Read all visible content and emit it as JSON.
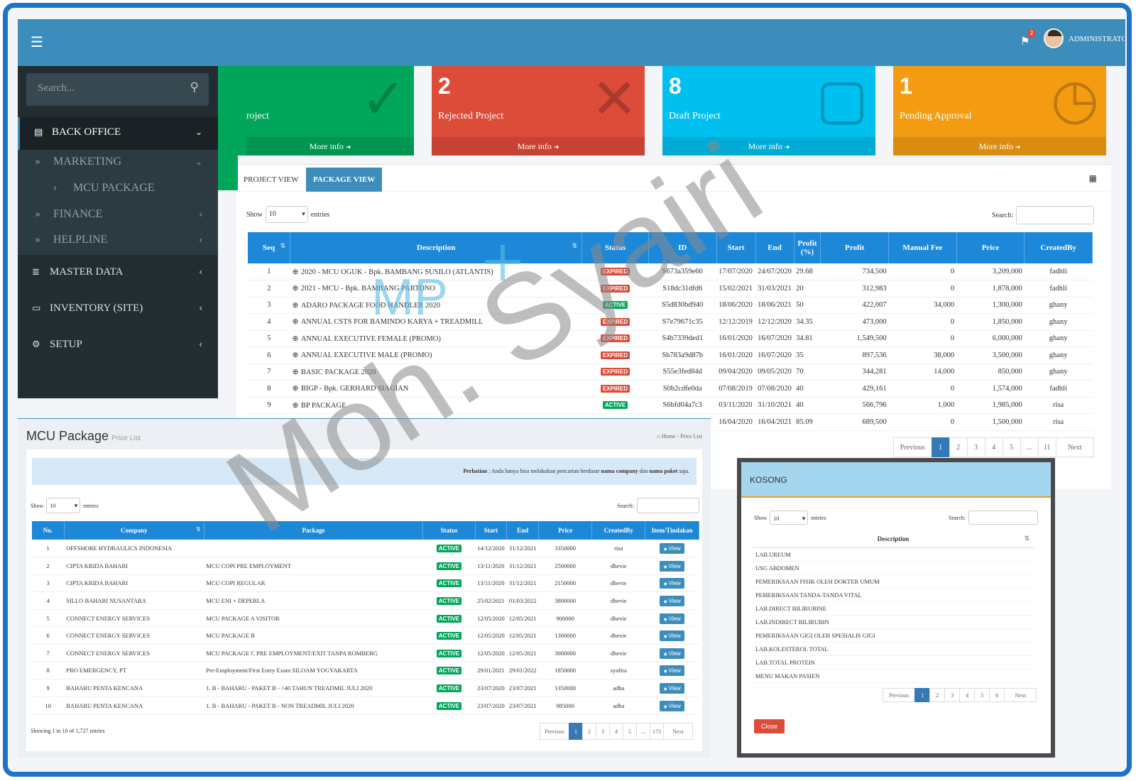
{
  "topbar": {
    "user": "ADMINISTRATOR",
    "flag_count": "2"
  },
  "sidebar": {
    "search_placeholder": "Search...",
    "items": [
      {
        "label": "BACK OFFICE"
      },
      {
        "label": "MARKETING"
      },
      {
        "label": "MCU PACKAGE"
      },
      {
        "label": "FINANCE"
      },
      {
        "label": "HELPLINE"
      },
      {
        "label": "MASTER DATA"
      },
      {
        "label": "INVENTORY (SITE)"
      },
      {
        "label": "SETUP"
      }
    ]
  },
  "info_boxes": [
    {
      "num": "",
      "label": "roject",
      "more": "More info",
      "color": "#00a65a"
    },
    {
      "num": "2",
      "label": "Rejected Project",
      "more": "More info",
      "color": "#dd4b39"
    },
    {
      "num": "8",
      "label": "Draft Project",
      "more": "More info",
      "color": "#00c0ef"
    },
    {
      "num": "1",
      "label": "Pending Approval",
      "more": "More info",
      "color": "#f39c12"
    }
  ],
  "tabs": {
    "project_view": "PROJECT VIEW",
    "package_view": "PACKAGE VIEW"
  },
  "pkg_table": {
    "show_label": "Show",
    "entries_value": "10",
    "entries_label": "entries",
    "search_label": "Search:",
    "headers": [
      "Seq",
      "Description",
      "Status",
      "ID",
      "Start",
      "End",
      "Profit (%)",
      "Profit",
      "Manual Fee",
      "Price",
      "CreatedBy"
    ],
    "rows": [
      [
        "1",
        "2020 - MCU OGUK - Bpk. BAMBANG SUSILO (ATLANTIS)",
        "EXPIRED",
        "S673a359e60",
        "17/07/2020",
        "24/07/2020",
        "29.68",
        "734,500",
        "0",
        "3,209,000",
        "fadhli"
      ],
      [
        "2",
        "2021 - MCU - Bpk. BAMBANG PARTONO",
        "EXPIRED",
        "S18dc31dfd6",
        "15/02/2021",
        "31/03/2021",
        "20",
        "312,983",
        "0",
        "1,878,000",
        "fadhli"
      ],
      [
        "3",
        "ADARO PACKAGE FOOD HANDLER 2020",
        "ACTIVE",
        "S5d830bd940",
        "18/06/2020",
        "18/06/2021",
        "50",
        "422,007",
        "34,000",
        "1,300,000",
        "ghany"
      ],
      [
        "4",
        "ANNUAL CSTS FOR BAMINDO KARYA + TREADMILL",
        "EXPIRED",
        "S7e79671c35",
        "12/12/2019",
        "12/12/2020",
        "34.35",
        "473,000",
        "0",
        "1,850,000",
        "ghany"
      ],
      [
        "5",
        "ANNUAL EXECUTIVE FEMALE (PROMO)",
        "EXPIRED",
        "S4b7339ded1",
        "16/01/2020",
        "16/07/2020",
        "34.81",
        "1,549,500",
        "0",
        "6,000,000",
        "ghany"
      ],
      [
        "6",
        "ANNUAL EXECUTIVE MALE (PROMO)",
        "EXPIRED",
        "Sb783a9d87b",
        "16/01/2020",
        "16/07/2020",
        "35",
        "897,536",
        "38,000",
        "3,500,000",
        "ghany"
      ],
      [
        "7",
        "BASIC PACKAGE 2020",
        "EXPIRED",
        "S55e3fed84d",
        "09/04/2020",
        "09/05/2020",
        "70",
        "344,281",
        "14,000",
        "850,000",
        "ghany"
      ],
      [
        "8",
        "BIGP - Bpk. GERHARD SIAGIAN",
        "EXPIRED",
        "S0b2cdfe0da",
        "07/08/2019",
        "07/08/2020",
        "40",
        "429,161",
        "0",
        "1,574,000",
        "fadhli"
      ],
      [
        "9",
        "BP PACKAGE",
        "ACTIVE",
        "S6bfd04a7c3",
        "03/11/2020",
        "31/10/2021",
        "40",
        "566,796",
        "1,000",
        "1,985,000",
        "risa"
      ],
      [
        "",
        "",
        "",
        "",
        "16/04/2020",
        "16/04/2021",
        "85.09",
        "689,500",
        "0",
        "1,500,000",
        "risa"
      ]
    ],
    "pager": [
      "Previous",
      "1",
      "2",
      "3",
      "4",
      "5",
      "...",
      "11",
      "Next"
    ]
  },
  "mcu": {
    "title": "MCU Package",
    "subtitle": "Price List",
    "crumb_home": "Home",
    "crumb_current": "Price List",
    "note_label": "Perhatian",
    "note_text": " : Anda hanya bisa melakukan pencarian berdasar ",
    "note_b1": "nama company",
    "note_mid": " dan ",
    "note_b2": "nama paket",
    "note_end": " saja.",
    "show_label": "Show",
    "entries_value": "10",
    "entries_label": "entries",
    "search_label": "Search:",
    "headers": [
      "No.",
      "Company",
      "Package",
      "Status",
      "Start",
      "End",
      "Price",
      "CreatedBy",
      "Item/Tindakan"
    ],
    "rows": [
      [
        "1",
        "OFFSHORE HYDRAULICS INDONESIA",
        "",
        "ACTIVE",
        "14/12/2020",
        "31/12/2021",
        "3350000",
        "risa",
        "View"
      ],
      [
        "2",
        "CIPTA KRIDA BAHARI",
        "MCU COPI PRE EMPLOYMENT",
        "ACTIVE",
        "13/11/2020",
        "31/12/2021",
        "2500000",
        "dhevie",
        "View"
      ],
      [
        "3",
        "CIPTA KRIDA BAHARI",
        "MCU COPI REGULAR",
        "ACTIVE",
        "13/11/2020",
        "31/12/2021",
        "2150000",
        "dhevie",
        "View"
      ],
      [
        "4",
        "SILLO BAHARI NUSANTARA",
        "MCU ENI + DEPERLA",
        "ACTIVE",
        "25/02/2021",
        "01/03/2022",
        "3800000",
        "dhevie",
        "View"
      ],
      [
        "5",
        "CONNECT ENERGY SERVICES",
        "MCU PACKAGE A VISITOR",
        "ACTIVE",
        "12/05/2020",
        "12/05/2021",
        "900000",
        "dhevie",
        "View"
      ],
      [
        "6",
        "CONNECT ENERGY SERVICES",
        "MCU PACKAGE B",
        "ACTIVE",
        "12/05/2020",
        "12/05/2021",
        "1300000",
        "dhevie",
        "View"
      ],
      [
        "7",
        "CONNECT ENERGY SERVICES",
        "MCU PACKAGE C PRE EMPLOYMENT/EXIT TANPA ROMBERG",
        "ACTIVE",
        "12/05/2020",
        "12/05/2021",
        "3000000",
        "dhevie",
        "View"
      ],
      [
        "8",
        "PRO EMERGENCY, PT",
        "Pre-Employment/First Entry Exam SILOAM YOGYAKARTA",
        "ACTIVE",
        "29/01/2021",
        "29/01/2022",
        "1850000",
        "syafira",
        "View"
      ],
      [
        "9",
        "BAHARU PENTA KENCANA",
        "1. B - BAHARU - PAKET B - >40 TAHUN TREADMIL JULI 2020",
        "ACTIVE",
        "23/07/2020",
        "23/07/2021",
        "1350000",
        "adha",
        "View"
      ],
      [
        "10",
        "BAHARU PENTA KENCANA",
        "1. B - BAHARU - PAKET B - NON TREADMIL JULI 2020",
        "ACTIVE",
        "23/07/2020",
        "23/07/2021",
        "985000",
        "adha",
        "View"
      ]
    ],
    "info": "Showing 1 to 10 of 1,727 entries",
    "pager": [
      "Previous",
      "1",
      "2",
      "3",
      "4",
      "5",
      "...",
      "173",
      "Next"
    ]
  },
  "modal": {
    "title": "KOSONG",
    "show_label": "Show",
    "entries_value": "10",
    "entries_label": "entries",
    "search_label": "Search:",
    "header": "Description",
    "rows": [
      "LAB.UREUM",
      "USG ABDOMEN",
      "PEMERIKSAAN FISIK OLEH DOKTER UMUM",
      "PEMERIKSAAN TANDA-TANDA VITAL",
      "LAB.DIRECT BILIRUBINE",
      "LAB.INDIRECT BILIRUBIN",
      "PEMERIKSAAN GIGI OLEH SPESIALIS GIGI",
      "LAB.KOLESTEROL TOTAL",
      "LAB.TOTAL PROTEIN",
      "MENU MAKAN PASIEN"
    ],
    "pager": [
      "Previous",
      "1",
      "2",
      "3",
      "4",
      "5",
      "6",
      "Next"
    ],
    "close": "Close"
  },
  "watermark": {
    "text": "Moh. Syairi",
    "logo": "MP"
  }
}
